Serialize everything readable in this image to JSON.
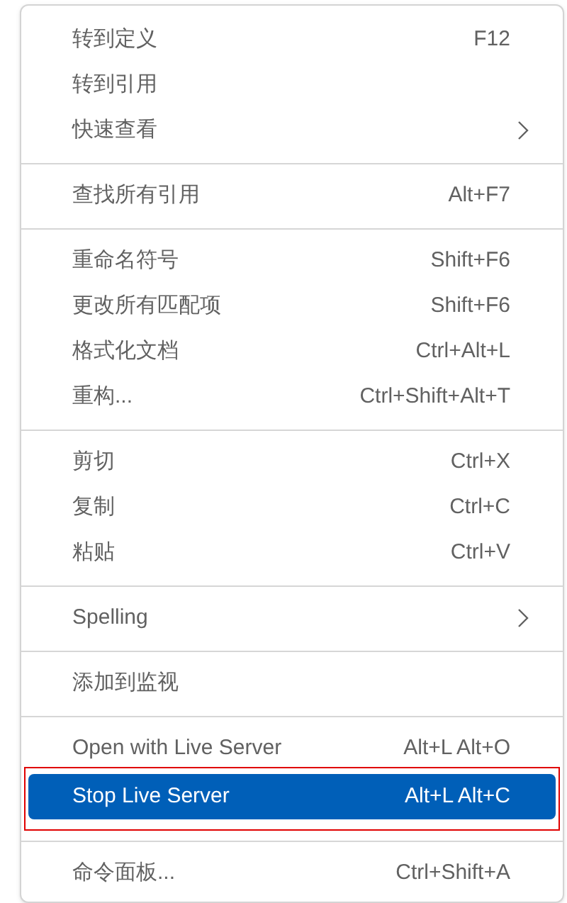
{
  "menu": {
    "groups": [
      [
        {
          "label": "转到定义",
          "shortcut": "F12",
          "submenu": false,
          "selected": false,
          "outlined": false
        },
        {
          "label": "转到引用",
          "submenu": false,
          "selected": false,
          "outlined": false
        },
        {
          "label": "快速查看",
          "submenu": true,
          "selected": false,
          "outlined": false
        }
      ],
      [
        {
          "label": "查找所有引用",
          "shortcut": "Alt+F7",
          "submenu": false,
          "selected": false,
          "outlined": false
        }
      ],
      [
        {
          "label": "重命名符号",
          "shortcut": "Shift+F6",
          "submenu": false,
          "selected": false,
          "outlined": false
        },
        {
          "label": "更改所有匹配项",
          "shortcut": "Shift+F6",
          "submenu": false,
          "selected": false,
          "outlined": false
        },
        {
          "label": "格式化文档",
          "shortcut": "Ctrl+Alt+L",
          "submenu": false,
          "selected": false,
          "outlined": false
        },
        {
          "label": "重构...",
          "shortcut": "Ctrl+Shift+Alt+T",
          "submenu": false,
          "selected": false,
          "outlined": false
        }
      ],
      [
        {
          "label": "剪切",
          "shortcut": "Ctrl+X",
          "submenu": false,
          "selected": false,
          "outlined": false
        },
        {
          "label": "复制",
          "shortcut": "Ctrl+C",
          "submenu": false,
          "selected": false,
          "outlined": false
        },
        {
          "label": "粘贴",
          "shortcut": "Ctrl+V",
          "submenu": false,
          "selected": false,
          "outlined": false
        }
      ],
      [
        {
          "label": "Spelling",
          "submenu": true,
          "selected": false,
          "outlined": false
        }
      ],
      [
        {
          "label": "添加到监视",
          "submenu": false,
          "selected": false,
          "outlined": false
        }
      ],
      [
        {
          "label": "Open with Live Server",
          "shortcut": "Alt+L Alt+O",
          "submenu": false,
          "selected": false,
          "outlined": false
        },
        {
          "label": "Stop Live Server",
          "shortcut": "Alt+L Alt+C",
          "submenu": false,
          "selected": true,
          "outlined": true
        }
      ],
      [
        {
          "label": "命令面板...",
          "shortcut": "Ctrl+Shift+A",
          "submenu": false,
          "selected": false,
          "outlined": false
        }
      ]
    ]
  }
}
